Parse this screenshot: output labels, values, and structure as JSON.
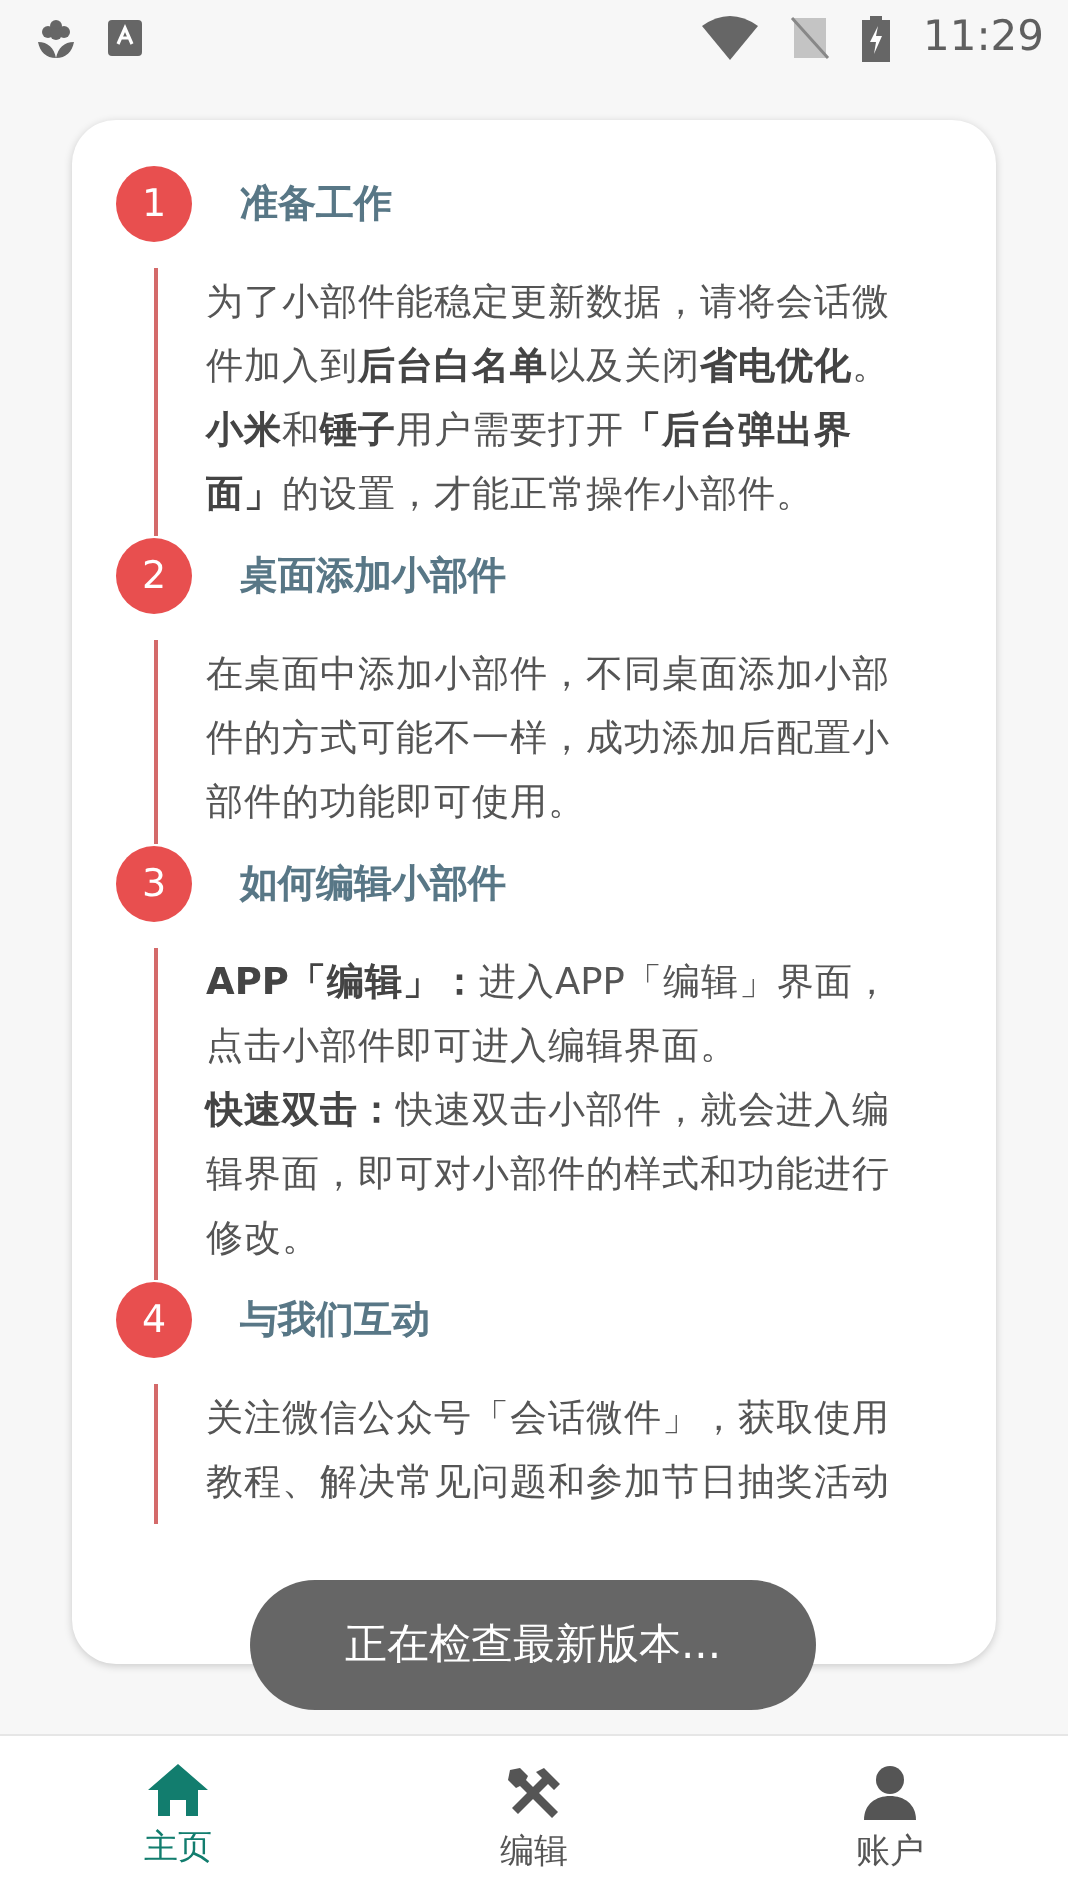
{
  "status_bar": {
    "time": "11:29"
  },
  "steps": [
    {
      "number": "1",
      "title": "准备工作",
      "paragraphs": [
        "为了小部件能稳定更新数据，请将会话微件加入到**后台白名单**以及关闭**省电优化**。",
        "**小米**和**锤子**用户需要打开**「后台弹出界面」**的设置，才能正常操作小部件。"
      ]
    },
    {
      "number": "2",
      "title": "桌面添加小部件",
      "paragraphs": [
        "在桌面中添加小部件，不同桌面添加小部件的方式可能不一样，成功添加后配置小部件的功能即可使用。"
      ]
    },
    {
      "number": "3",
      "title": "如何编辑小部件",
      "paragraphs": [
        "**APP「编辑」：**进入APP「编辑」界面，点击小部件即可进入编辑界面。",
        "**快速双击：**快速双击小部件，就会进入编辑界面，即可对小部件的样式和功能进行修改。"
      ]
    },
    {
      "number": "4",
      "title": "与我们互动",
      "paragraphs": [
        "关注微信公众号「会话微件」，获取使用教程、解决常见问题和参加节日抽奖活动"
      ]
    }
  ],
  "toast": "正在检查最新版本...",
  "bottom_nav": [
    {
      "label": "主页",
      "kind": "home",
      "selected": true
    },
    {
      "label": "编辑",
      "kind": "tools",
      "selected": false
    },
    {
      "label": "账户",
      "kind": "person",
      "selected": false
    }
  ]
}
